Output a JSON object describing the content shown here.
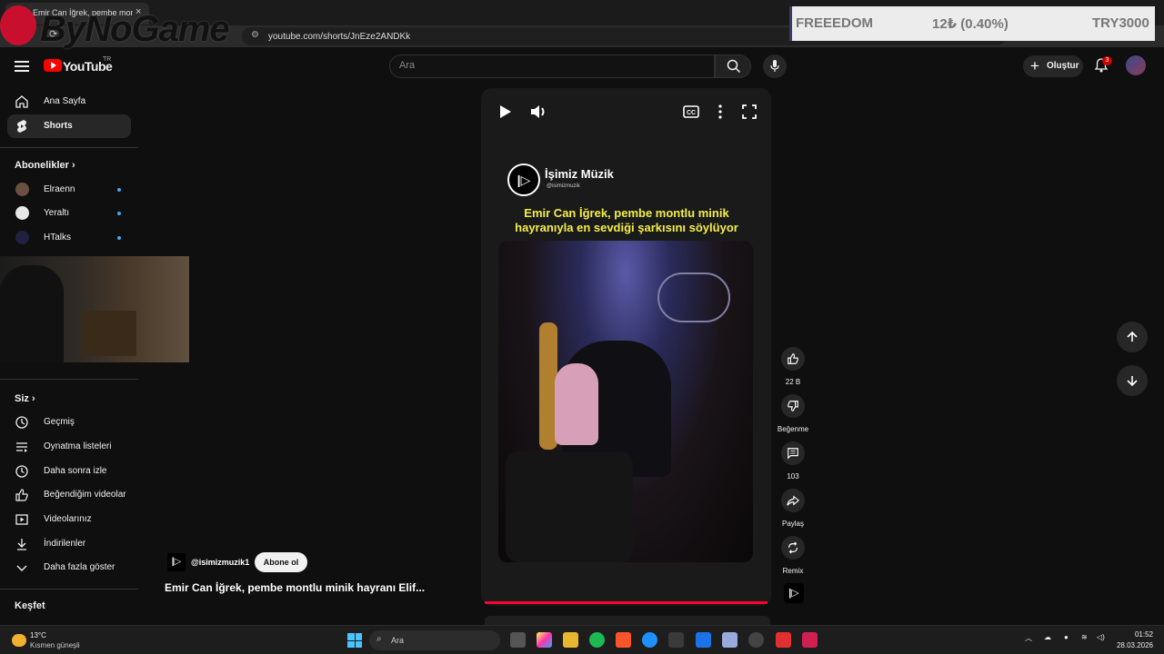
{
  "browser": {
    "tab_title": "Emir Can İğrek, pembe montl",
    "tab_close": "×",
    "url": "youtube.com/shorts/JnEze2ANDKk"
  },
  "watermark": {
    "text": "ByNoGame"
  },
  "ticker": {
    "name": "FREEEDOM",
    "change": "12₺ (0.40%)",
    "target": "TRY3000"
  },
  "header": {
    "brand": "YouTube",
    "region": "TR",
    "search_placeholder": "Ara",
    "create_label": "Oluştur",
    "notification_count": "3"
  },
  "sidebar": {
    "main": [
      {
        "label": "Ana Sayfa",
        "icon": "home-icon"
      },
      {
        "label": "Shorts",
        "icon": "shorts-icon",
        "active": true
      }
    ],
    "subscriptions_heading": "Abonelikler",
    "subscriptions": [
      {
        "label": "Elraenn"
      },
      {
        "label": "Yeraltı"
      },
      {
        "label": "HTalks"
      }
    ],
    "you_heading": "Siz",
    "you": [
      {
        "label": "Geçmiş",
        "icon": "history-icon"
      },
      {
        "label": "Oynatma listeleri",
        "icon": "playlists-icon"
      },
      {
        "label": "Daha sonra izle",
        "icon": "watch-later-icon"
      },
      {
        "label": "Beğendiğim videolar",
        "icon": "liked-icon"
      },
      {
        "label": "Videolarınız",
        "icon": "your-videos-icon"
      },
      {
        "label": "İndirilenler",
        "icon": "downloads-icon"
      },
      {
        "label": "Daha fazla göster",
        "icon": "chevron-down-icon"
      }
    ],
    "explore_heading": "Keşfet"
  },
  "short": {
    "channel_name": "İşimiz Müzik",
    "channel_handle": "@isimizmuzik",
    "caption_line1": "Emir Can İğrek, pembe montlu minik",
    "caption_line2": "hayranıyla en sevdiği şarkısını söylüyor",
    "progress": 1.0
  },
  "actions": {
    "likes": "22 B",
    "dislike_label": "Beğenme",
    "comments": "103",
    "share_label": "Paylaş",
    "remix_label": "Remix"
  },
  "video_info": {
    "handle": "@isimizmuzik1",
    "subscribe_label": "Abone ol",
    "title": "Emir Can İğrek, pembe montlu minik hayranı Elif..."
  },
  "taskbar": {
    "temp": "13°C",
    "weather": "Kısmen güneşli",
    "search_label": "Ara",
    "time": "01:52",
    "date": "28.03.2026"
  }
}
